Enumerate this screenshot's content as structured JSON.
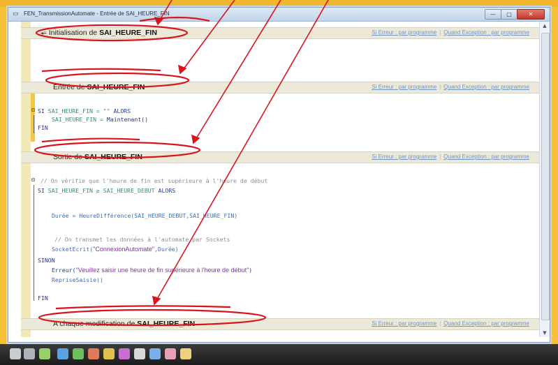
{
  "window": {
    "title": "FEN_TransmissionAutomate - Entrée de SAI_HEURE_FIN",
    "title_icon": "code-window-icon",
    "buttons": {
      "minimize": "—",
      "maximize": "□",
      "close": "✕"
    }
  },
  "links": {
    "error": "Si Erreur : par programme",
    "exception": "Quand Exception : par programme"
  },
  "sections": [
    {
      "label_prefix": "Initialisation de ",
      "label_name": "SAI_HEURE_FIN",
      "icon": "◂≡"
    },
    {
      "label_prefix": "Entrée de ",
      "label_name": "SAI_HEURE_FIN"
    },
    {
      "label_prefix": "Sortie de ",
      "label_name": "SAI_HEURE_FIN"
    },
    {
      "label_prefix": "A chaque modification de ",
      "label_name": "SAI_HEURE_FIN"
    }
  ],
  "code": {
    "entree": [
      {
        "kw1": "SI ",
        "var1": "SAI_HEURE_FIN",
        "op": " = \"\" ",
        "kw2": "ALORS"
      },
      {
        "var": "SAI_HEURE_FIN",
        "op": " = ",
        "fn": "Maintenant()"
      },
      {
        "kw": "FIN"
      }
    ],
    "sortie": {
      "comment1": "// On vérifie que l'heure de fin est supérieure à l'heure de début",
      "si_kw": "SI ",
      "si_expr": "SAI_HEURE_FIN ≥ SAI_HEURE_DEBUT ",
      "alors": "ALORS",
      "duree_line": "Durée = HeureDifférence(SAI_HEURE_DEBUT,SAI_HEURE_FIN)",
      "comment2": "// On transmet les données à l'automate par Sockets",
      "socket_fn": "SocketEcrit(",
      "socket_str": "\"ConnexionAutomate\"",
      "socket_rest": ",Durée)",
      "sinon": "SINON",
      "erreur_fn": "Erreur(",
      "erreur_str": "\"Veuillez saisir une heure de fin supérieure à l'heure de début\"",
      "erreur_rest": ")",
      "reprise": "RepriseSaisie()",
      "fin": "FIN"
    }
  },
  "colors": {
    "annotation_red": "#d8141c",
    "background_yellow": "#f6c13a",
    "header_bg": "#ece9d8",
    "link_blue": "#6f93c4"
  },
  "taskbar": {
    "icons": [
      "app-icon-1",
      "app-icon-2",
      "app-icon-3",
      "app-icon-4",
      "app-icon-5",
      "app-icon-6",
      "app-icon-7",
      "app-icon-8",
      "app-icon-9",
      "app-icon-10",
      "app-icon-11",
      "app-icon-12"
    ]
  }
}
